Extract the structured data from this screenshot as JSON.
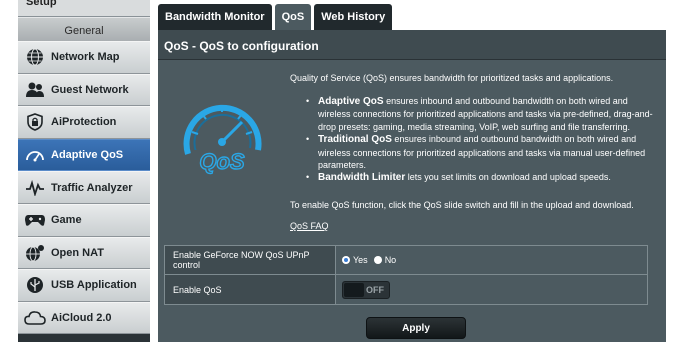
{
  "sidebar": {
    "top_label": "Setup",
    "section_header": "General",
    "items": [
      {
        "label": "Network Map",
        "icon": "globe-icon",
        "active": false
      },
      {
        "label": "Guest Network",
        "icon": "people-icon",
        "active": false
      },
      {
        "label": "AiProtection",
        "icon": "shield-lock-icon",
        "active": false
      },
      {
        "label": "Adaptive QoS",
        "icon": "speedometer-icon",
        "active": true
      },
      {
        "label": "Traffic Analyzer",
        "icon": "pulse-icon",
        "active": false
      },
      {
        "label": "Game",
        "icon": "gamepad-icon",
        "active": false
      },
      {
        "label": "Open NAT",
        "icon": "nat-globe-icon",
        "active": false
      },
      {
        "label": "USB Application",
        "icon": "usb-icon",
        "active": false
      },
      {
        "label": "AiCloud 2.0",
        "icon": "cloud-icon",
        "active": false
      }
    ]
  },
  "tabs": [
    {
      "label": "Bandwidth Monitor",
      "active": false
    },
    {
      "label": "QoS",
      "active": true
    },
    {
      "label": "Web History",
      "active": false
    }
  ],
  "title": "QoS - QoS to configuration",
  "intro": "Quality of Service (QoS) ensures bandwidth for prioritized tasks and applications.",
  "bullets": [
    {
      "term": "Adaptive QoS",
      "text": " ensures inbound and outbound bandwidth on both wired and wireless connections for prioritized applications and tasks via pre-defined, drag-and-drop presets: gaming, media streaming, VoIP, web surfing and file transferring."
    },
    {
      "term": "Traditional QoS",
      "text": " ensures inbound and outbound bandwidth on both wired and wireless connections for prioritized applications and tasks via manual user-defined parameters."
    },
    {
      "term": "Bandwidth Limiter",
      "text": " lets you set limits on download and upload speeds."
    }
  ],
  "enable_text": "To enable QoS function, click the QoS slide switch and fill in the upload and download.",
  "faq_label": "QoS FAQ",
  "logo_text": "QoS",
  "settings": {
    "geforce": {
      "label": "Enable GeForce NOW QoS UPnP control",
      "yes": "Yes",
      "no": "No",
      "selected": "Yes"
    },
    "qos": {
      "label": "Enable QoS",
      "toggle_text": "OFF",
      "enabled": false
    }
  },
  "apply_label": "Apply",
  "colors": {
    "accent": "#3b7ed6",
    "panel": "#4c5a60",
    "sidebar_active": "#2f66a8",
    "logo_blue": "#2aa7e6"
  }
}
